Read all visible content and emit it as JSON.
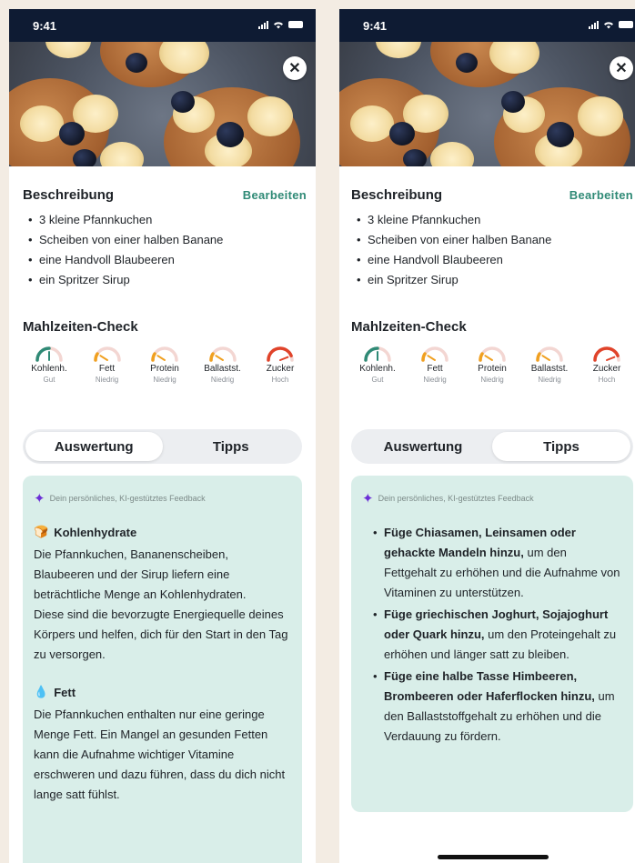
{
  "status": {
    "time": "9:41"
  },
  "description": {
    "title": "Beschreibung",
    "edit_label": "Bearbeiten",
    "items": [
      "3 kleine Pfannkuchen",
      "Scheiben von einer halben Banane",
      "eine Handvoll Blaubeeren",
      "ein Spritzer Sirup"
    ]
  },
  "meal_check": {
    "title": "Mahlzeiten-Check",
    "gauges": [
      {
        "name": "Kohlenh.",
        "level": "Gut",
        "value": 0.5,
        "color": "#2f8a76"
      },
      {
        "name": "Fett",
        "level": "Niedrig",
        "value": 0.18,
        "color": "#f0a020"
      },
      {
        "name": "Protein",
        "level": "Niedrig",
        "value": 0.18,
        "color": "#f0a020"
      },
      {
        "name": "Ballastst.",
        "level": "Niedrig",
        "value": 0.18,
        "color": "#f0a020"
      },
      {
        "name": "Zucker",
        "level": "Hoch",
        "value": 0.88,
        "color": "#e0432a"
      }
    ]
  },
  "tabs": {
    "evaluation": "Auswertung",
    "tips": "Tipps"
  },
  "feedback": {
    "header": "Dein persönliches, KI-gestütztes Feedback",
    "evaluation": [
      {
        "icon": "bread-icon",
        "title": "Kohlenhydrate",
        "text_1": "Die Pfannkuchen, Bananenscheiben, Blaubeeren und der Sirup liefern eine beträchtliche Menge an Kohlenhydraten.",
        "text_2": "Diese sind die bevorzugte Energiequelle deines Körpers und helfen, dich für den Start in den Tag zu versorgen."
      },
      {
        "icon": "oil-drop-icon",
        "title": "Fett",
        "text_1": "Die Pfannkuchen enthalten nur eine geringe Menge Fett. Ein Mangel an gesunden Fetten kann die Aufnahme wichtiger Vitamine erschweren und dazu führen, dass du dich nicht lange satt fühlst."
      }
    ],
    "tips": [
      {
        "bold": "Füge Chiasamen, Leinsamen oder gehackte Mandeln hinzu,",
        "rest": " um den Fettgehalt zu erhöhen und die Aufnahme von Vitaminen zu unterstützen."
      },
      {
        "bold": "Füge griechischen Joghurt, Sojajoghurt oder Quark hinzu,",
        "rest": " um den Proteingehalt zu erhöhen und länger satt zu bleiben."
      },
      {
        "bold": "Füge eine halbe Tasse Himbeeren, Brombeeren oder Haferflocken hinzu,",
        "rest": " um den Ballaststoffgehalt zu erhöhen und die Verdauung zu fördern."
      }
    ]
  }
}
